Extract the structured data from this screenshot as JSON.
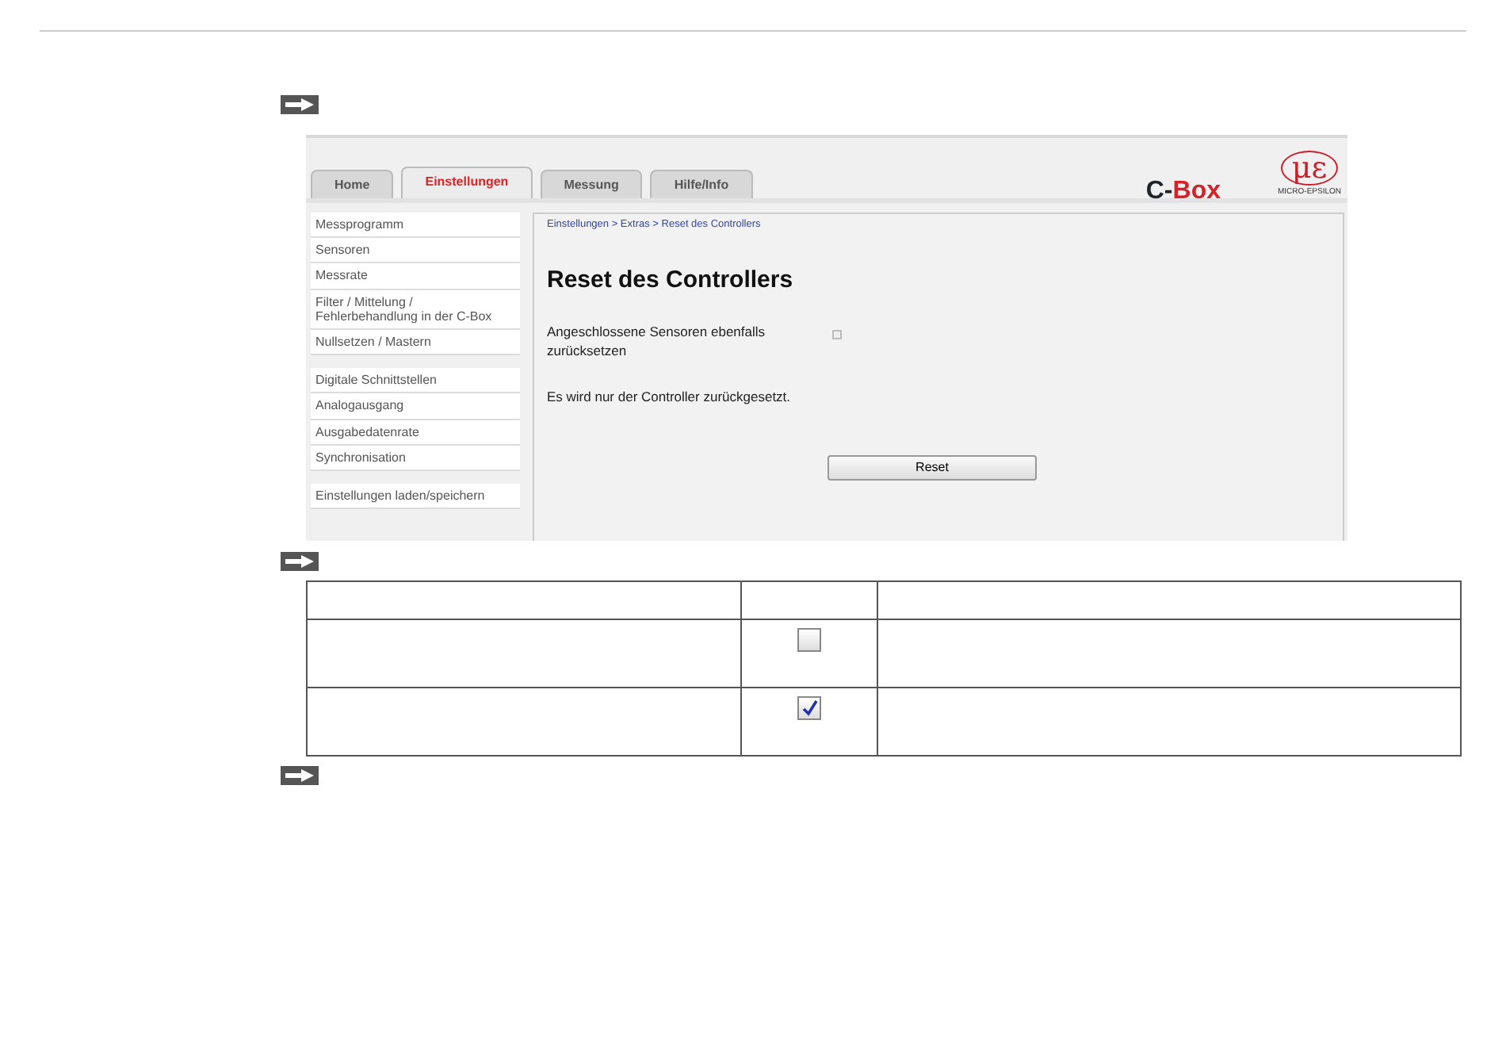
{
  "app_screenshot": {
    "tabs": [
      {
        "label": "Home",
        "selected": false
      },
      {
        "label": "Einstellungen",
        "selected": true
      },
      {
        "label": "Messung",
        "selected": false
      },
      {
        "label": "Hilfe/Info",
        "selected": false
      }
    ],
    "brand": {
      "prefix": "C-",
      "suffix": "Box"
    },
    "logo": {
      "symbol": "με",
      "name": "MICRO-EPSILON"
    },
    "sidebar": {
      "groups": [
        [
          "Messprogramm",
          "Sensoren",
          "Messrate",
          "Filter / Mittelung / Fehlerbehandlung in der C-Box",
          "Nullsetzen / Mastern"
        ],
        [
          "Digitale Schnittstellen",
          "Analogausgang",
          "Ausgabedatenrate",
          "Synchronisation"
        ],
        [
          "Einstellungen laden/speichern"
        ]
      ]
    },
    "breadcrumb": "Einstellungen > Extras > Reset des Controllers",
    "heading": "Reset des Controllers",
    "option": {
      "label": "Angeschlossene Sensoren ebenfalls zurücksetzen",
      "checked": false
    },
    "info": "Es wird nur der Controller zurückgesetzt.",
    "button": "Reset"
  },
  "table": {
    "rows": [
      {
        "checked": false
      },
      {
        "checked": true
      }
    ]
  }
}
